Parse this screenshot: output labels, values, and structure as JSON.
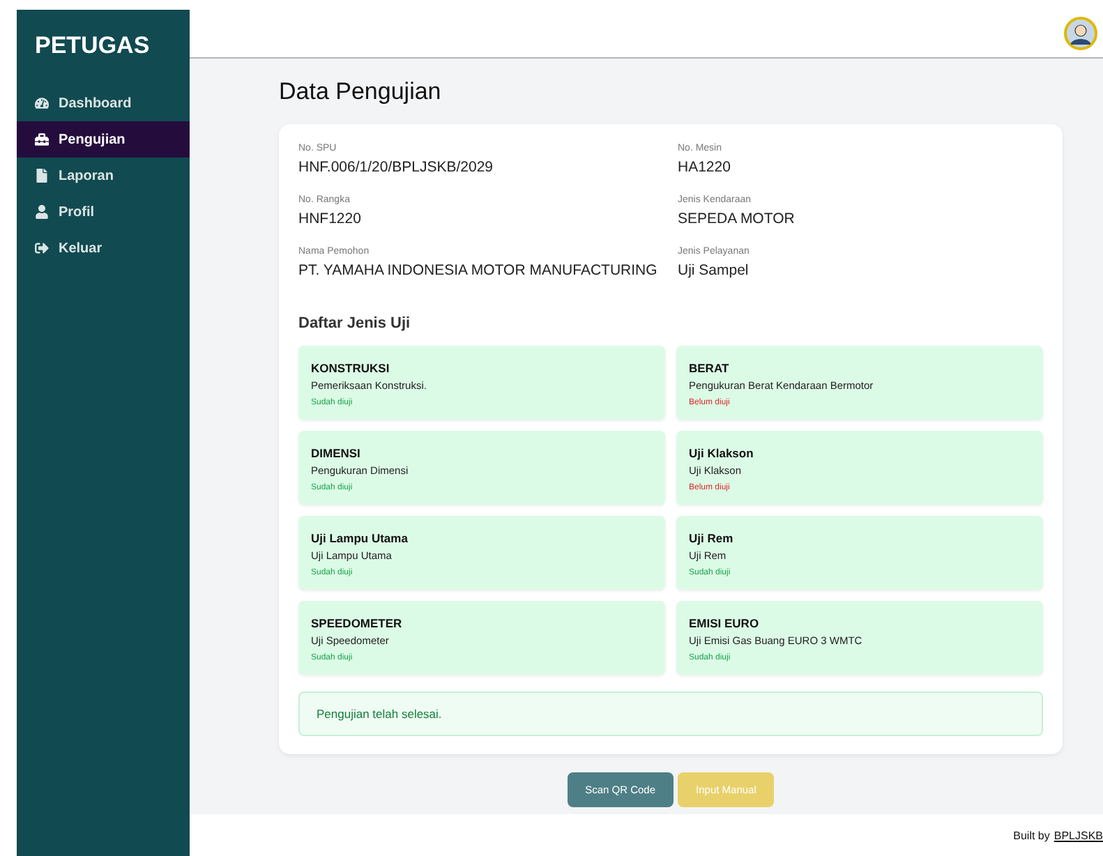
{
  "sidebar": {
    "title": "PETUGAS",
    "items": [
      {
        "label": "Dashboard",
        "selected": false
      },
      {
        "label": "Pengujian",
        "selected": true
      },
      {
        "label": "Laporan",
        "selected": false
      },
      {
        "label": "Profil",
        "selected": false
      },
      {
        "label": "Keluar",
        "selected": false
      }
    ]
  },
  "page_title": "Data Pengujian",
  "details": [
    {
      "label": "No. SPU",
      "value": "HNF.006/1/20/BPLJSKB/2029"
    },
    {
      "label": "No. Mesin",
      "value": "HA1220"
    },
    {
      "label": "No. Rangka",
      "value": "HNF1220"
    },
    {
      "label": "Jenis Kendaraan",
      "value": "SEPEDA MOTOR"
    },
    {
      "label": "Nama Pemohon",
      "value": "PT. YAMAHA INDONESIA MOTOR MANUFACTURING"
    },
    {
      "label": "Jenis Pelayanan",
      "value": "Uji Sampel"
    }
  ],
  "tests_title": "Daftar Jenis Uji",
  "tests": [
    {
      "name": "KONSTRUKSI",
      "description": "Pemeriksaan Konstruksi.",
      "status": "Sudah diuji",
      "tested": true
    },
    {
      "name": "BERAT",
      "description": "Pengukuran Berat Kendaraan Bermotor",
      "status": "Belum diuji",
      "tested": false
    },
    {
      "name": "DIMENSI",
      "description": "Pengukuran Dimensi",
      "status": "Sudah diuji",
      "tested": true
    },
    {
      "name": "Uji Klakson",
      "description": "Uji Klakson",
      "status": "Belum diuji",
      "tested": false
    },
    {
      "name": "Uji Lampu Utama",
      "description": "Uji Lampu Utama",
      "status": "Sudah diuji",
      "tested": true
    },
    {
      "name": "Uji Rem",
      "description": "Uji Rem",
      "status": "Sudah diuji",
      "tested": true
    },
    {
      "name": "SPEEDOMETER",
      "description": "Uji Speedometer",
      "status": "Sudah diuji",
      "tested": true
    },
    {
      "name": "EMISI EURO",
      "description": "Uji Emisi Gas Buang EURO 3 WMTC",
      "status": "Sudah diuji",
      "tested": true
    }
  ],
  "alert": "Pengujian telah selesai.",
  "buttons": [
    {
      "label": "Scan QR Code",
      "kind": "primary"
    },
    {
      "label": "Input Manual",
      "kind": "secondary"
    }
  ],
  "footer": {
    "text": "Built by",
    "link": "BPLJSKB"
  }
}
